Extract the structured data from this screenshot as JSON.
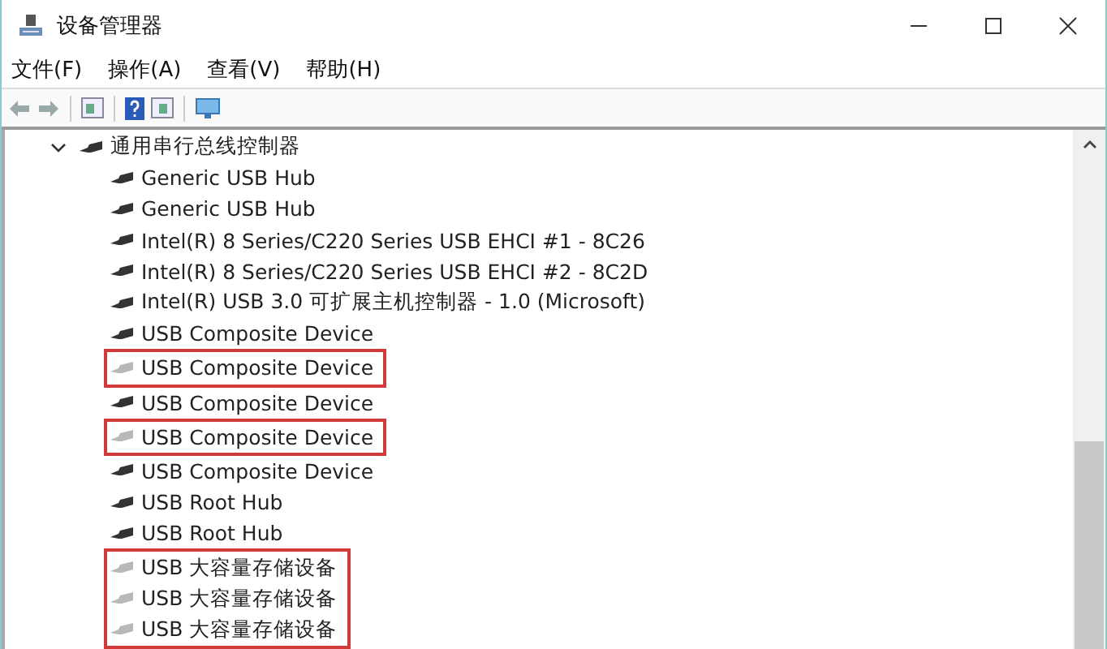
{
  "window": {
    "title": "设备管理器"
  },
  "menu": [
    "文件(F)",
    "操作(A)",
    "查看(V)",
    "帮助(H)"
  ],
  "tree": [
    {
      "label": "通用串行总线控制器",
      "expanded": true,
      "children": [
        {
          "label": "Generic USB Hub",
          "disabled": false,
          "highlighted": false
        },
        {
          "label": "Generic USB Hub",
          "disabled": false,
          "highlighted": false
        },
        {
          "label": "Intel(R) 8 Series/C220 Series USB EHCI #1 - 8C26",
          "disabled": false,
          "highlighted": false
        },
        {
          "label": "Intel(R) 8 Series/C220 Series USB EHCI #2 - 8C2D",
          "disabled": false,
          "highlighted": false
        },
        {
          "label": "Intel(R) USB 3.0 可扩展主机控制器 - 1.0 (Microsoft)",
          "disabled": false,
          "highlighted": false
        },
        {
          "label": "USB Composite Device",
          "disabled": false,
          "highlighted": false
        },
        {
          "label": "USB Composite Device",
          "disabled": true,
          "highlighted": true
        },
        {
          "label": "USB Composite Device",
          "disabled": false,
          "highlighted": false
        },
        {
          "label": "USB Composite Device",
          "disabled": true,
          "highlighted": true
        },
        {
          "label": "USB Composite Device",
          "disabled": false,
          "highlighted": false
        },
        {
          "label": "USB Root Hub",
          "disabled": false,
          "highlighted": false
        },
        {
          "label": "USB Root Hub",
          "disabled": false,
          "highlighted": false
        },
        {
          "label": "USB 大容量存储设备",
          "disabled": true,
          "highlighted": true
        },
        {
          "label": "USB 大容量存储设备",
          "disabled": true,
          "highlighted": true
        },
        {
          "label": "USB 大容量存储设备",
          "disabled": true,
          "highlighted": true
        }
      ]
    }
  ]
}
